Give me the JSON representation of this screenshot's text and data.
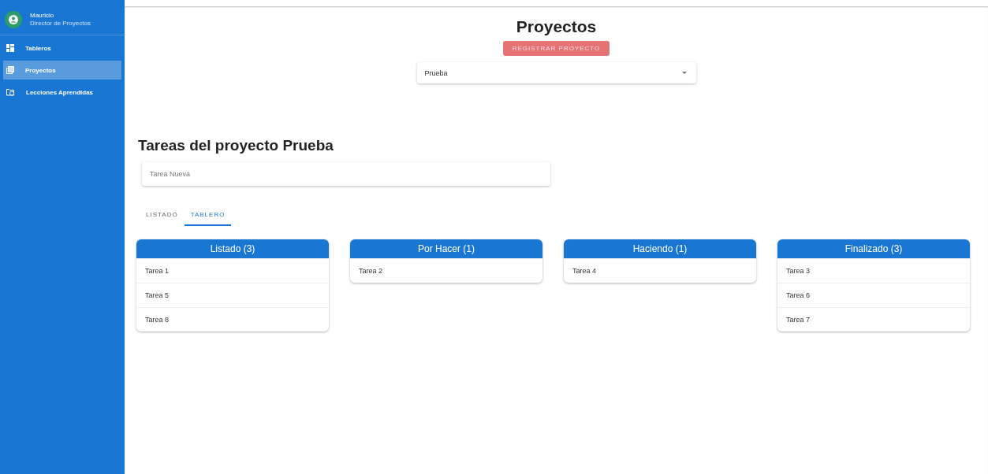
{
  "sidebar": {
    "user": {
      "name": "Mauricio",
      "role": "Director de Proyectos"
    },
    "items": [
      {
        "label": "Tableros",
        "selected": false
      },
      {
        "label": "Proyectos",
        "selected": true
      },
      {
        "label": "Lecciones Aprendidas",
        "selected": false
      }
    ]
  },
  "page": {
    "title": "Proyectos",
    "register_button": "REGISTRAR PROYECTO",
    "project_select": {
      "value": "Prueba"
    }
  },
  "tasks": {
    "heading": "Tareas del proyecto Prueba",
    "new_task": {
      "placeholder": "Tarea Nueva"
    },
    "tabs": [
      {
        "label": "LISTADO",
        "selected": false
      },
      {
        "label": "TABLERO",
        "selected": true
      }
    ],
    "columns": [
      {
        "title": "Listado (3)",
        "tasks": [
          "Tarea 1",
          "Tarea 5",
          "Tarea 8"
        ]
      },
      {
        "title": "Por Hacer (1)",
        "tasks": [
          "Tarea 2"
        ]
      },
      {
        "title": "Haciendo (1)",
        "tasks": [
          "Tarea 4"
        ]
      },
      {
        "title": "Finalizado (3)",
        "tasks": [
          "Tarea 3",
          "Tarea 6",
          "Tarea 7"
        ]
      }
    ]
  }
}
